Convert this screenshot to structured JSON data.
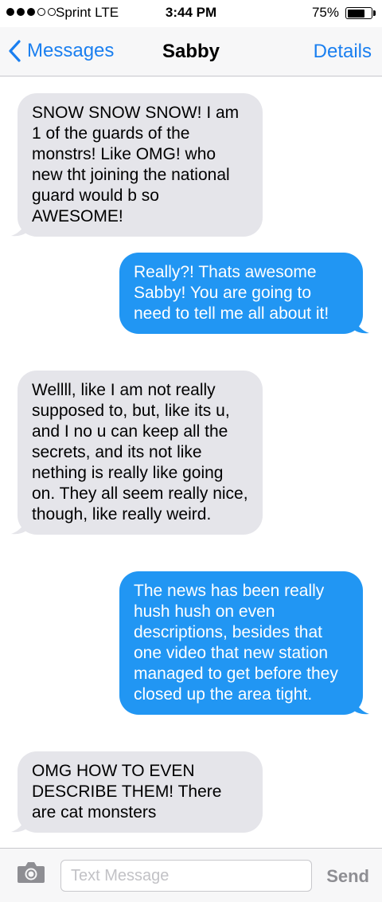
{
  "status_bar": {
    "carrier": "Sprint  LTE",
    "time": "3:44 PM",
    "battery": "75%",
    "battery_level": 0.75,
    "signal_bars_filled": 3,
    "signal_bars_total": 5
  },
  "nav": {
    "back_label": "Messages",
    "title": "Sabby",
    "details_label": "Details"
  },
  "colors": {
    "accent": "#1a7ff0",
    "sent_bubble": "#2196f3",
    "received_bubble": "#e5e5ea"
  },
  "messages": [
    {
      "direction": "received",
      "text": "SNOW SNOW SNOW! I am 1 of the guards of the monstrs! Like OMG! who new tht joining the national guard would b so AWESOME!"
    },
    {
      "direction": "sent",
      "text": "Really?! Thats awesome Sabby! You are going to need to tell me all about it!"
    },
    {
      "direction": "received",
      "text": "Wellll, like I am not really supposed to, but, like its u, and I no u can keep all the secrets, and its not like nething is really like going on. They all seem really nice, though, like really weird."
    },
    {
      "direction": "sent",
      "text": "The news has been really hush hush on even descriptions, besides that one video that new station managed to get before they closed up the area tight."
    },
    {
      "direction": "received",
      "text": "OMG HOW TO EVEN DESCRIBE THEM! There are cat monsters"
    }
  ],
  "input_bar": {
    "placeholder": "Text Message",
    "value": "",
    "send_label": "Send",
    "camera_icon": "camera-icon"
  }
}
